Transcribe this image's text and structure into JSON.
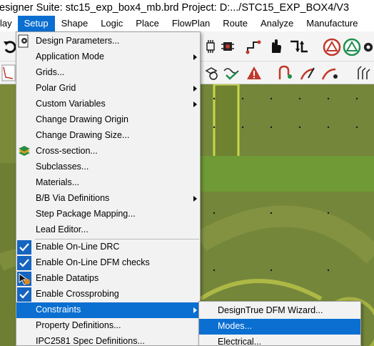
{
  "window": {
    "title": "esigner Suite: stc15_exp_box4_mb.brd  Project: D:.../STC15_EXP_BOX4/V3"
  },
  "menubar": {
    "items": [
      "lay",
      "Setup",
      "Shape",
      "Logic",
      "Place",
      "FlowPlan",
      "Route",
      "Analyze",
      "Manufacture"
    ],
    "active": "Setup"
  },
  "setup_menu": {
    "items": [
      {
        "label": "Design Parameters...",
        "icon": "design-parameters-icon"
      },
      {
        "label": "Application Mode",
        "submenu": true
      },
      {
        "label": "Grids..."
      },
      {
        "label": "Polar Grid",
        "submenu": true
      },
      {
        "label": "Custom Variables",
        "submenu": true
      },
      {
        "label": "Change Drawing Origin"
      },
      {
        "label": "Change Drawing Size..."
      },
      {
        "label": "Cross-section...",
        "icon": "cross-section-icon"
      },
      {
        "label": "Subclasses..."
      },
      {
        "label": "Materials..."
      },
      {
        "label": "B/B Via Definitions",
        "submenu": true
      },
      {
        "label": "Step Package Mapping..."
      },
      {
        "label": "Lead Editor..."
      },
      {
        "label": "Enable On-Line DRC",
        "checked": true
      },
      {
        "label": "Enable On-Line DFM checks",
        "checked": true
      },
      {
        "label": "Enable Datatips",
        "icon": "datatips-icon"
      },
      {
        "label": "Enable Crossprobing",
        "checked": true
      },
      {
        "label": "Constraints",
        "submenu": true,
        "highlighted": true
      },
      {
        "label": "Property Definitions..."
      },
      {
        "label": "IPC2581 Spec Definitions..."
      }
    ]
  },
  "constraints_submenu": {
    "items": [
      {
        "label": "DesignTrue DFM Wizard..."
      },
      {
        "label": "Modes...",
        "highlighted": true
      },
      {
        "label": "Electrical..."
      }
    ]
  },
  "colors": {
    "accent": "#0b6fd1",
    "canvas": "#6c7e31",
    "check": "#1565c0"
  }
}
